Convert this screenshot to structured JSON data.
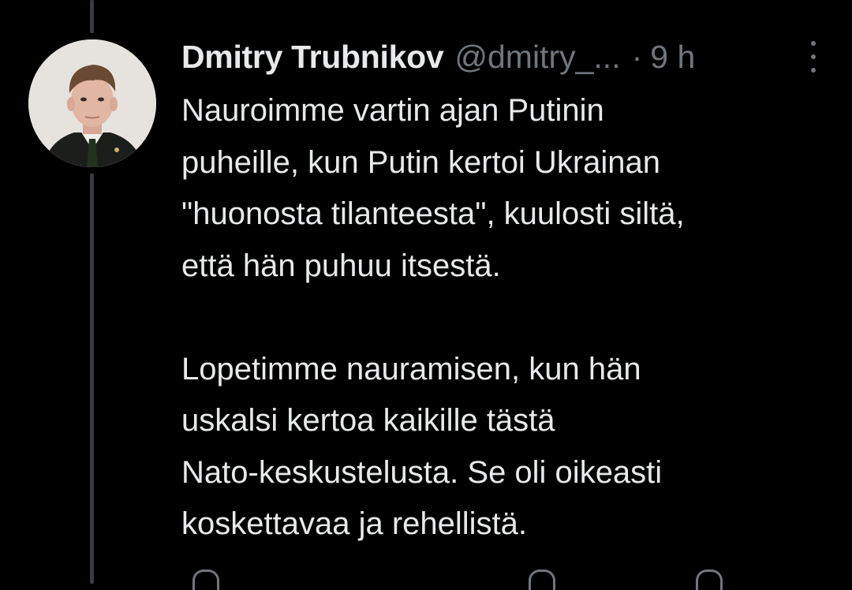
{
  "tweet": {
    "author": {
      "name": "Dmitry Trubnikov",
      "handle": "@dmitry_...",
      "avatar_alt": "profile photo"
    },
    "separator": "·",
    "time": "9 h",
    "more_icon": "more-vertical-icon",
    "paragraphs": [
      "Nauroimme vartin ajan Putinin\npuheille, kun Putin kertoi Ukrainan\n\"huonosta tilanteesta\", kuulosti siltä,\nettä hän puhuu itsestä.",
      "Lopetimme nauramisen, kun hän\nuskalsi kertoa kaikille tästä\nNato-keskustelusta. Se oli oikeasti\nkoskettavaa ja rehellistä."
    ]
  },
  "colors": {
    "background": "#000000",
    "text_primary": "#e7e9ea",
    "text_secondary": "#71767b",
    "thread_line": "#3a3d40"
  }
}
